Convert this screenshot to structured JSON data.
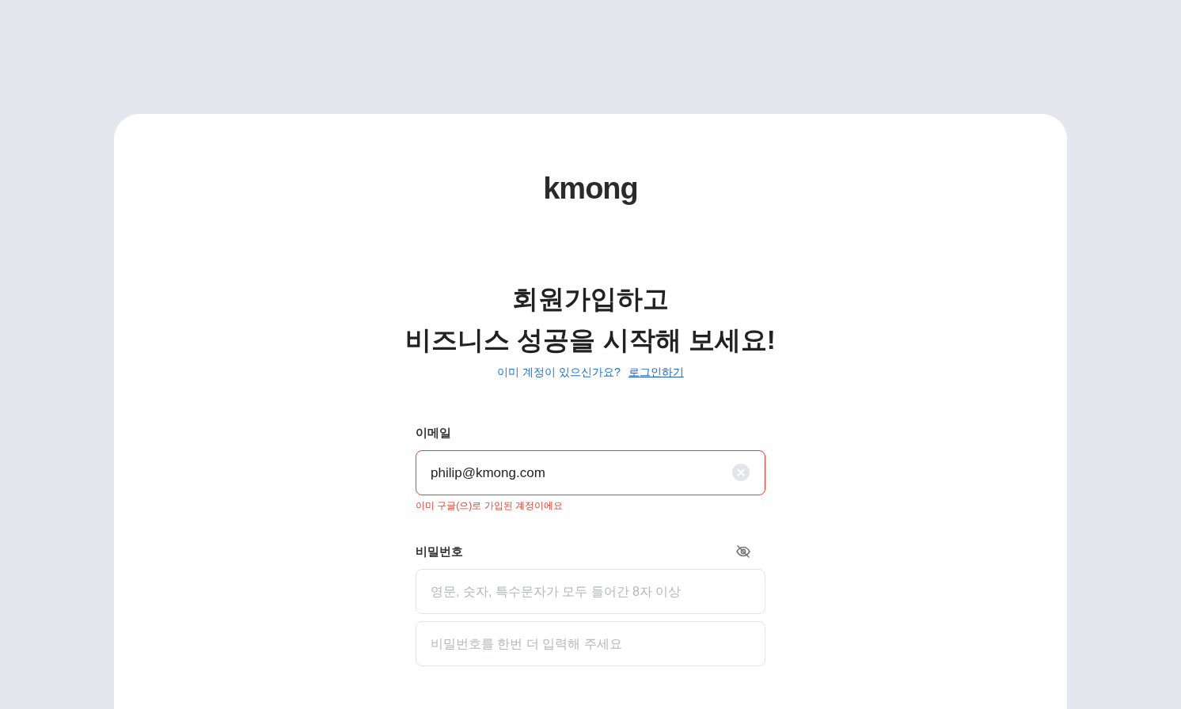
{
  "logo": "kmong",
  "heading": [
    "회원가입하고",
    "비즈니스 성공을 시작해 보세요!"
  ],
  "login_prompt": {
    "text": "이미 계정이 있으신가요?",
    "link": "로그인하기"
  },
  "email": {
    "label": "이메일",
    "value": "philip@kmong.com",
    "error": "이미 구글(으)로 가입된 계정이에요"
  },
  "password": {
    "label": "비밀번호",
    "visible": false,
    "placeholder": "영문, 숫자, 특수문자가 모두 들어간 8자 이상",
    "confirm_placeholder": "비밀번호를 한번 더 입력해 주세요"
  }
}
